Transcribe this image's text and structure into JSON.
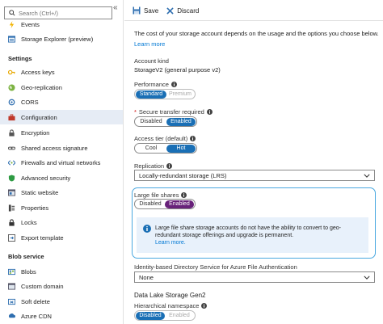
{
  "sidebar": {
    "search_placeholder": "Search (Ctrl+/)",
    "collapse_glyph": "«",
    "top_items": [
      {
        "label": "Events",
        "icon": "events-icon"
      },
      {
        "label": "Storage Explorer (preview)",
        "icon": "storage-explorer-icon"
      }
    ],
    "settings_header": "Settings",
    "settings_items": [
      {
        "label": "Access keys"
      },
      {
        "label": "Geo-replication"
      },
      {
        "label": "CORS"
      },
      {
        "label": "Configuration"
      },
      {
        "label": "Encryption"
      },
      {
        "label": "Shared access signature"
      },
      {
        "label": "Firewalls and virtual networks"
      },
      {
        "label": "Advanced security"
      },
      {
        "label": "Static website"
      },
      {
        "label": "Properties"
      },
      {
        "label": "Locks"
      },
      {
        "label": "Export template"
      }
    ],
    "blob_header": "Blob service",
    "blob_items": [
      {
        "label": "Blobs"
      },
      {
        "label": "Custom domain"
      },
      {
        "label": "Soft delete"
      },
      {
        "label": "Azure CDN"
      }
    ]
  },
  "toolbar": {
    "save_label": "Save",
    "discard_label": "Discard"
  },
  "main": {
    "intro": "The cost of your storage account depends on the usage and the options you choose below.",
    "learn_more": "Learn more",
    "account_kind_label": "Account kind",
    "account_kind_value": "StorageV2 (general purpose v2)",
    "performance_label": "Performance",
    "performance_options": [
      "Standard",
      "Premium"
    ],
    "secure_transfer_required_mark": "*",
    "secure_transfer_label": "Secure transfer required",
    "secure_transfer_options": [
      "Disabled",
      "Enabled"
    ],
    "access_tier_label": "Access tier (default)",
    "access_tier_options": [
      "Cool",
      "Hot"
    ],
    "replication_label": "Replication",
    "replication_value": "Locally-redundant storage (LRS)",
    "large_file_shares_label": "Large file shares",
    "large_file_shares_options": [
      "Disabled",
      "Enabled"
    ],
    "info_message": "Large file share storage accounts do not have the ability to convert to geo-redundant storage offerings and upgrade is permanent.",
    "info_learn_more": "Learn more.",
    "identity_label": "Identity-based Directory Service for Azure File Authentication",
    "identity_value": "None",
    "dls_title": "Data Lake Storage Gen2",
    "hns_label": "Hierarchical namespace",
    "hns_options": [
      "Disabled",
      "Enabled"
    ]
  },
  "colors": {
    "accent": "#1a6fb5",
    "purple": "#68217a",
    "highlight_border": "#4aa8e0",
    "info_bg": "#e8f1fb",
    "link": "#0078d4"
  }
}
